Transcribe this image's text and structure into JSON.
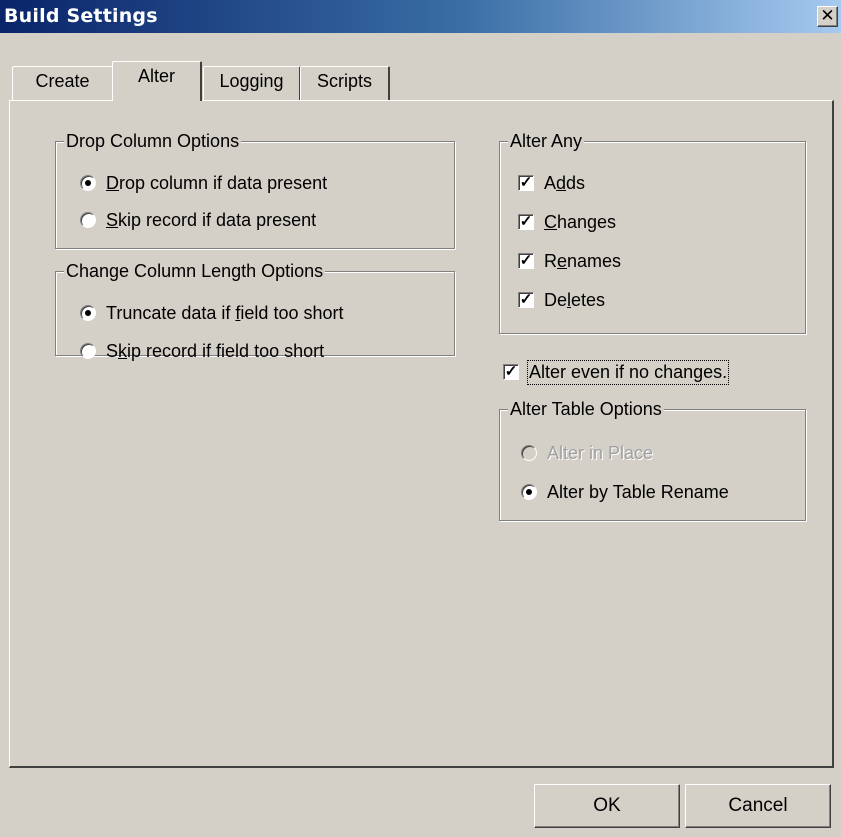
{
  "window": {
    "title": "Build Settings",
    "close_glyph": "✕"
  },
  "tabs": [
    {
      "label": "Create",
      "active": false
    },
    {
      "label": "Alter",
      "active": true
    },
    {
      "label": "Logging",
      "active": false
    },
    {
      "label": "Scripts",
      "active": false
    }
  ],
  "drop_column": {
    "legend": "Drop Column Options",
    "options": [
      {
        "mnemonic": "D",
        "rest": "rop column if data present",
        "checked": true
      },
      {
        "mnemonic": "S",
        "rest": "kip record if data present",
        "checked": false
      }
    ]
  },
  "change_length": {
    "legend": "Change Column Length Options",
    "options": [
      {
        "before": "Truncate data if ",
        "mnemonic": "f",
        "rest": "ield too short",
        "checked": true
      },
      {
        "before": "S",
        "mnemonic": "k",
        "rest": "ip record if field too short",
        "checked": false
      }
    ]
  },
  "alter_any": {
    "legend": "Alter Any",
    "items": [
      {
        "before": "A",
        "mnemonic": "d",
        "rest": "ds",
        "checked": true
      },
      {
        "before": "",
        "mnemonic": "C",
        "rest": "hanges",
        "checked": true
      },
      {
        "before": "R",
        "mnemonic": "e",
        "rest": "names",
        "checked": true
      },
      {
        "before": "De",
        "mnemonic": "l",
        "rest": "etes",
        "checked": true
      }
    ]
  },
  "alter_even": {
    "label": "Alter even if no changes.",
    "checked": true
  },
  "alter_table": {
    "legend": "Alter Table Options",
    "options": [
      {
        "label": "Alter in Place",
        "checked": false,
        "disabled": true
      },
      {
        "label": "Alter by Table Rename",
        "checked": true,
        "disabled": false
      }
    ]
  },
  "buttons": {
    "ok": "OK",
    "cancel": "Cancel"
  },
  "checkmark": "✓"
}
